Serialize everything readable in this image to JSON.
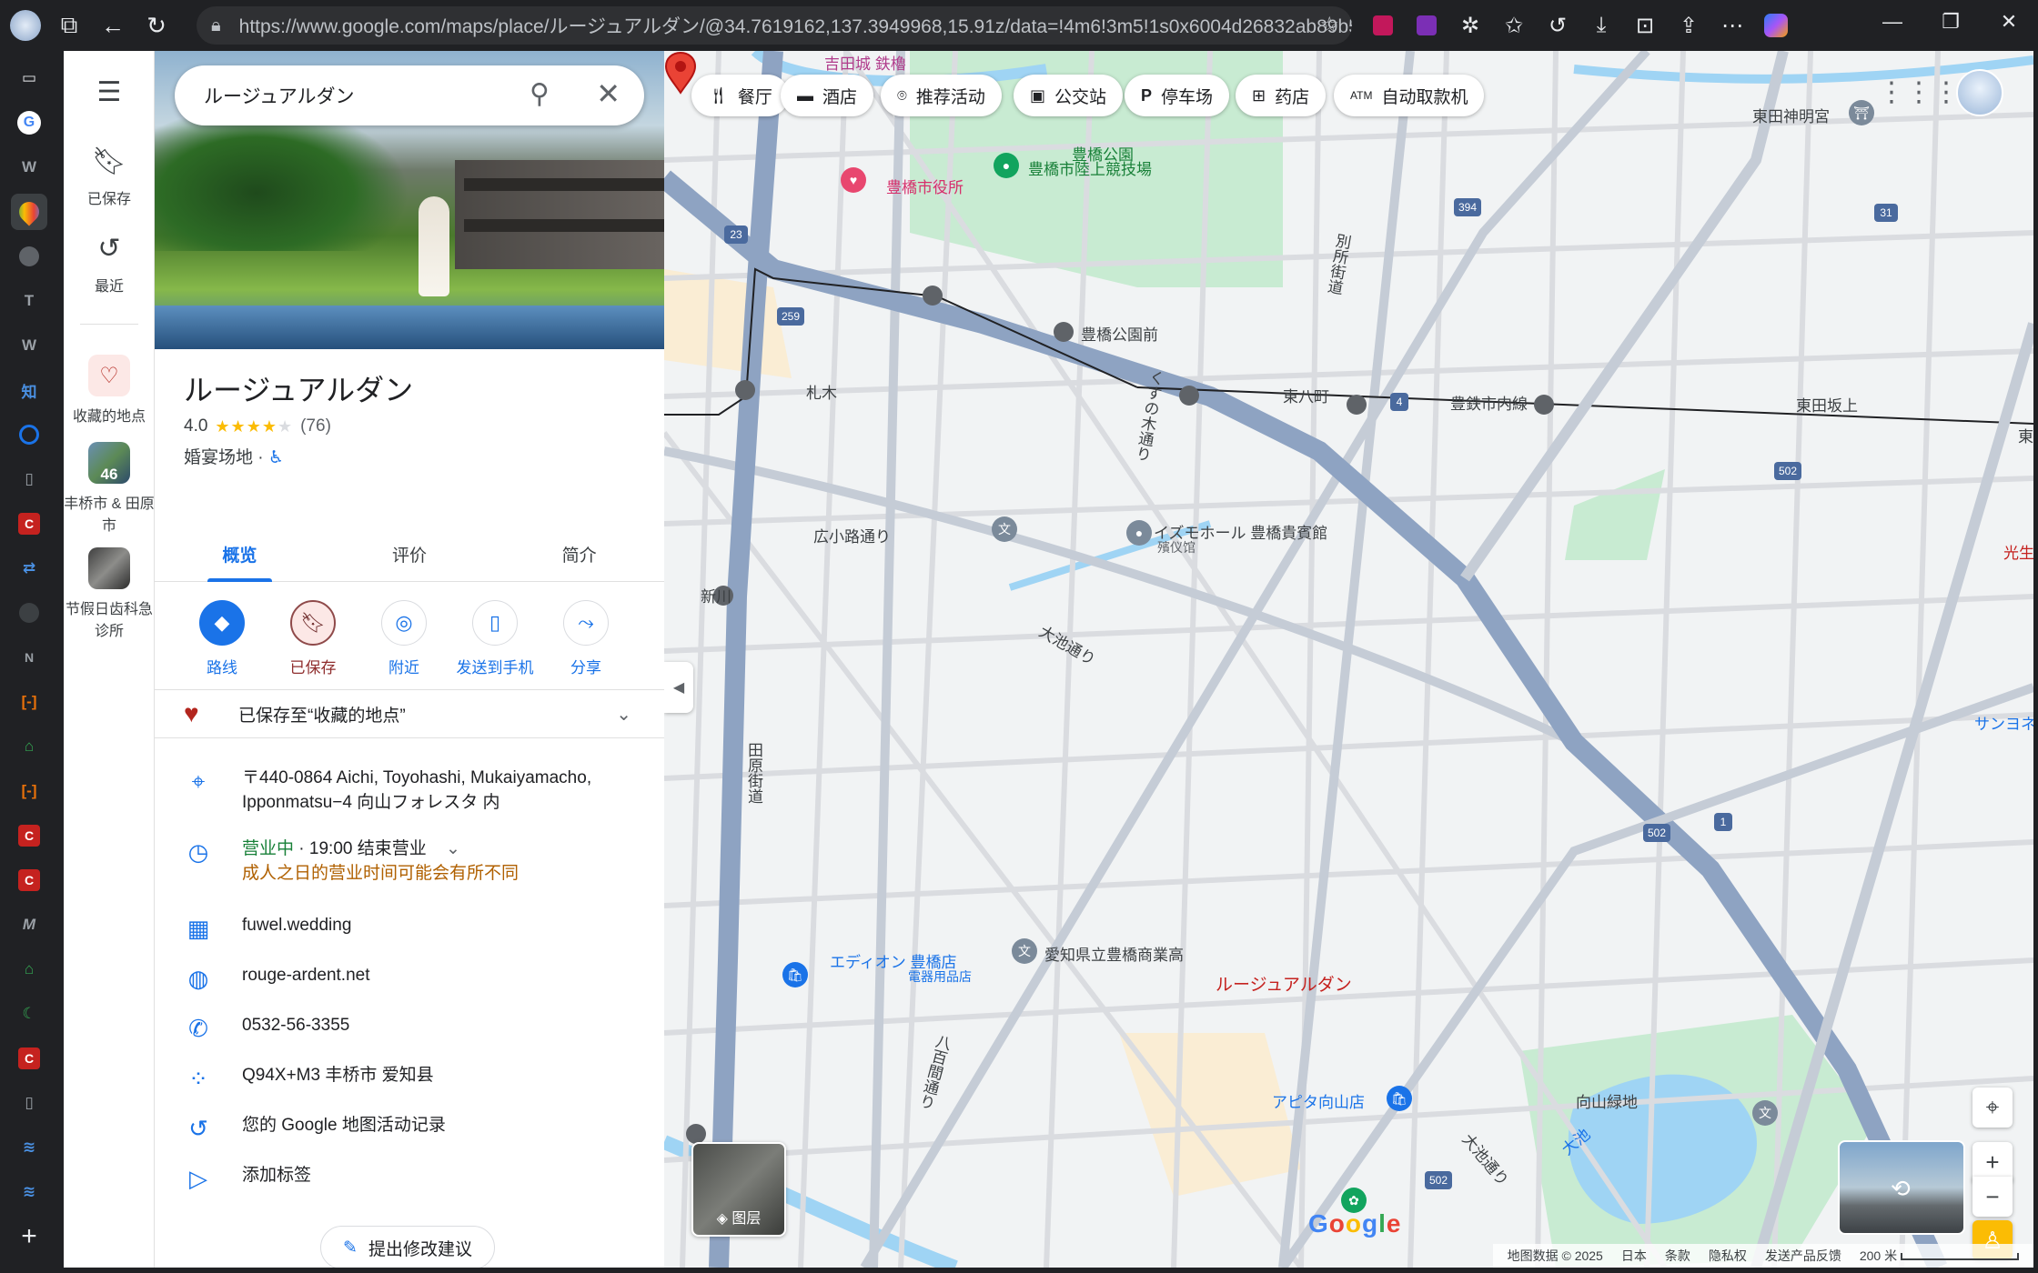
{
  "browser": {
    "url": "https://www.google.com/maps/place/ルージュアルダン/@34.7619162,137.3949968,15.91z/data=!4m6!3m5!1s0x6004d26832ab89b5:0xe8f7..."
  },
  "rail": {
    "saved": "已保存",
    "recent": "最近",
    "favorites": "收藏的地点",
    "place1_badge": "46",
    "place1": "丰桥市 & 田原市",
    "place2": "节假日齿科急诊所"
  },
  "panel": {
    "search_value": "ルージュアルダン",
    "title": "ルージュアルダン",
    "rating": "4.0",
    "review_count": "(76)",
    "category": "婚宴场地 · ",
    "tabs": [
      "概览",
      "评价",
      "简介"
    ],
    "actions": [
      "路线",
      "已保存",
      "附近",
      "发送到手机",
      "分享"
    ],
    "saved_to": "已保存至“收藏的地点”",
    "address": "〒440-0864 Aichi, Toyohashi, Mukaiyamacho, Ipponmatsu−4 向山フォレスタ 内",
    "hours_open": "营业中",
    "hours_close": " · 19:00 结束营业",
    "hours_warning": "成人之日的营业时间可能会有所不同",
    "menu_site": "fuwel.wedding",
    "website": "rouge-ardent.net",
    "phone": "0532-56-3355",
    "plus_code": "Q94X+M3 丰桥市 爱知县",
    "activity": "您的 Google 地图活动记录",
    "add_label": "添加标签",
    "suggest_edit": "提出修改建议"
  },
  "map": {
    "chips": [
      "餐厅",
      "酒店",
      "推荐活动",
      "公交站",
      "停车场",
      "药店",
      "自动取款机"
    ],
    "labels": {
      "yoshida": "吉田城 鉄櫓",
      "park": "豊橋公園",
      "cityhall": "豊橋市役所",
      "stadium": "豊橋市陸上競技場",
      "higashida_shrine": "東田神明宮",
      "koen_mae": "豊橋公園前",
      "fudagi": "札木",
      "higashi_hatcho": "東八町",
      "line": "豊鉄市内線",
      "higashida_sakaue": "東田坂上",
      "betsusho": "別所街道",
      "kusunoki": "くすの木通り",
      "hirokoji": "広小路通り",
      "shinkawa": "新川",
      "oike": "大池通り",
      "imasumo": "イズモホール 豊橋貴賓館",
      "funeral": "殯仪馆",
      "tahara": "田原街道",
      "edion": "エディオン 豊橋店",
      "edion_sub": "電器用品店",
      "school": "愛知県立豊橋商業高",
      "target": "ルージュアルダン",
      "yahyakken": "八百間通り",
      "apita": "アピタ向山店",
      "mukaiyama": "向山緑地",
      "oike_pond": "大池",
      "oike2": "大池通り",
      "sanyo": "サンヨネ",
      "kosei": "光生",
      "higashi": "東"
    },
    "route_numbers": [
      "23",
      "259",
      "394",
      "31",
      "4",
      "502",
      "502",
      "1",
      "502"
    ],
    "layers": "图层",
    "google": "Google",
    "attribution": [
      "地图数据 © 2025",
      "日本",
      "条款",
      "隐私权",
      "发送产品反馈",
      "200 米"
    ]
  }
}
